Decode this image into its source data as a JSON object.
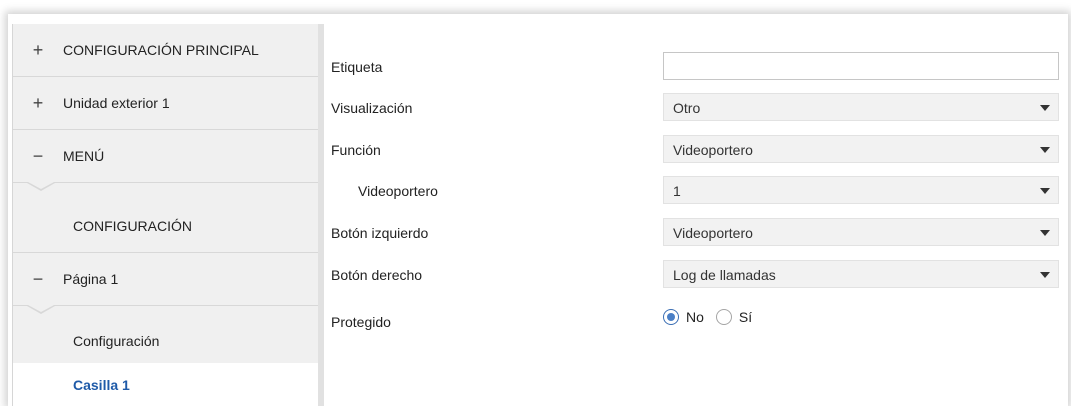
{
  "sidebar": {
    "items": [
      {
        "sign": "+",
        "label": "CONFIGURACIÓN PRINCIPAL"
      },
      {
        "sign": "+",
        "label": "Unidad exterior 1"
      },
      {
        "sign": "−",
        "label": "MENÚ"
      },
      {
        "sign": "",
        "label": "CONFIGURACIÓN"
      },
      {
        "sign": "−",
        "label": "Página 1"
      },
      {
        "sign": "",
        "label": "Configuración"
      },
      {
        "sign": "",
        "label": "Casilla 1"
      }
    ]
  },
  "form": {
    "etiqueta": {
      "label": "Etiqueta",
      "value": ""
    },
    "visualizacion": {
      "label": "Visualización",
      "value": "Otro"
    },
    "funcion": {
      "label": "Función",
      "value": "Videoportero"
    },
    "videoportero": {
      "label": "Videoportero",
      "value": "1"
    },
    "boton_izquierdo": {
      "label": "Botón izquierdo",
      "value": "Videoportero"
    },
    "boton_derecho": {
      "label": "Botón derecho",
      "value": "Log de llamadas"
    },
    "protegido": {
      "label": "Protegido",
      "options": [
        "No",
        "Sí"
      ],
      "selected": "No"
    }
  },
  "colors": {
    "selected_text": "#1e5aa8",
    "radio_accent": "#4a7fc6"
  }
}
